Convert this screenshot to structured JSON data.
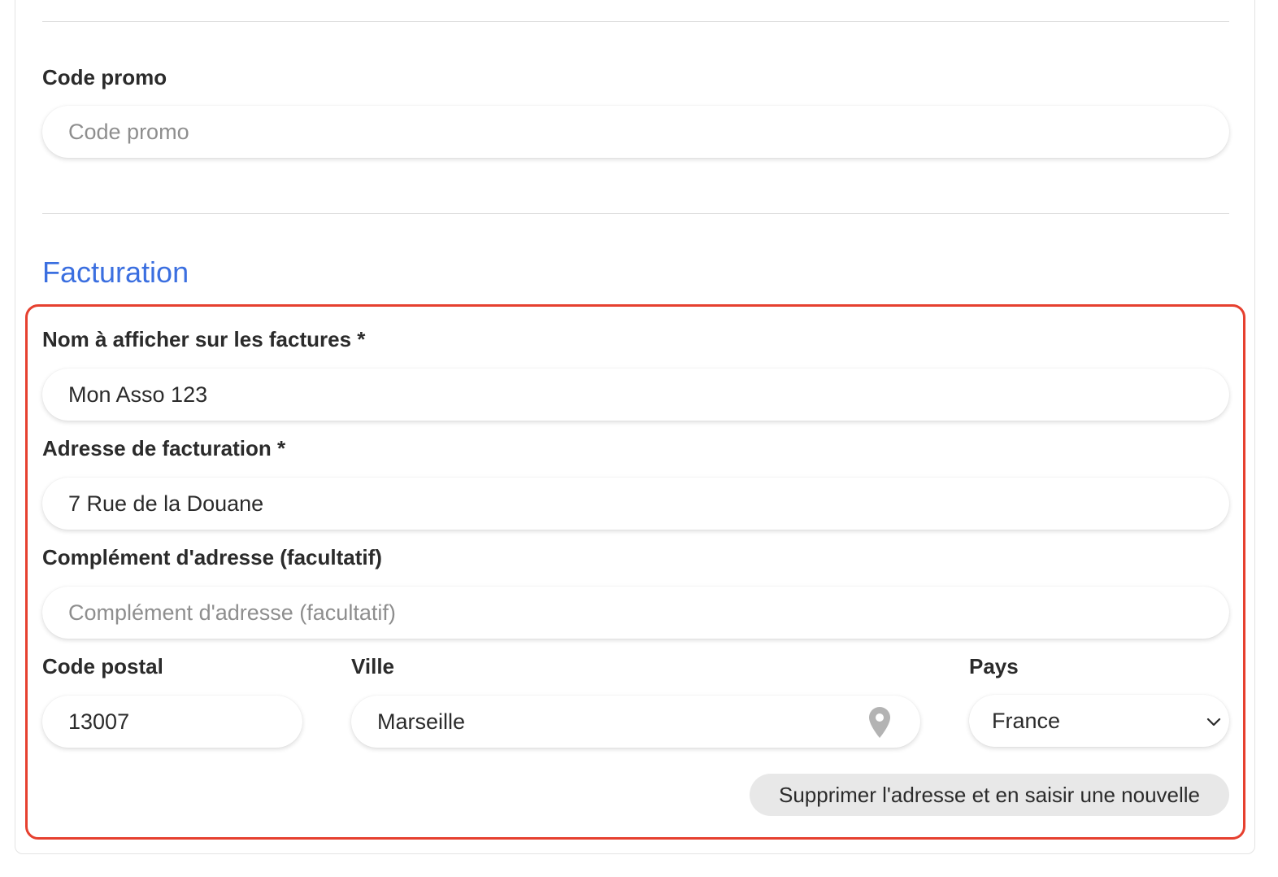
{
  "promo": {
    "label": "Code promo",
    "placeholder": "Code promo",
    "value": ""
  },
  "billing": {
    "section_title": "Facturation",
    "invoice_name": {
      "label": "Nom à afficher sur les factures *",
      "value": "Mon Asso 123"
    },
    "address": {
      "label": "Adresse de facturation *",
      "value": "7 Rue de la Douane"
    },
    "address_complement": {
      "label": "Complément d'adresse (facultatif)",
      "placeholder": "Complément d'adresse (facultatif)",
      "value": ""
    },
    "postal_code": {
      "label": "Code postal",
      "value": "13007"
    },
    "city": {
      "label": "Ville",
      "value": "Marseille",
      "icon": "location-pin-icon"
    },
    "country": {
      "label": "Pays",
      "value": "France",
      "icon": "chevron-down-icon"
    },
    "reset_button": "Supprimer l'adresse et en saisir une nouvelle"
  },
  "colors": {
    "accent": "#3b6fe0",
    "highlight_border": "#e6402f",
    "button_bg": "#e8e8e8"
  }
}
